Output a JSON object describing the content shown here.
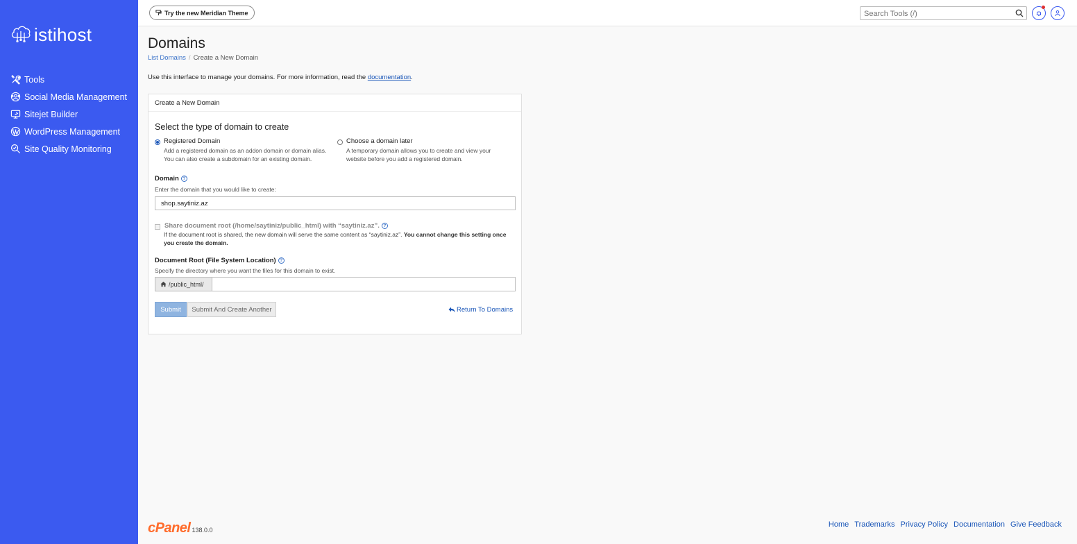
{
  "brand": {
    "name": "istihost",
    "sidebar_color": "#3b5af0"
  },
  "sidebar": {
    "items": [
      {
        "label": "Tools",
        "icon": "tools-icon"
      },
      {
        "label": "Social Media Management",
        "icon": "social-icon"
      },
      {
        "label": "Sitejet Builder",
        "icon": "monitor-icon"
      },
      {
        "label": "WordPress Management",
        "icon": "wordpress-icon"
      },
      {
        "label": "Site Quality Monitoring",
        "icon": "search-magnify-icon"
      }
    ]
  },
  "topbar": {
    "theme_button": "Try the new Meridian Theme",
    "search_placeholder": "Search Tools (/)"
  },
  "page": {
    "title": "Domains",
    "breadcrumb": {
      "parent": "List Domains",
      "current": "Create a New Domain"
    },
    "intro_text": "Use this interface to manage your domains. For more information, read the ",
    "intro_link": "documentation",
    "intro_end": "."
  },
  "panel": {
    "heading": "Create a New Domain",
    "section_title": "Select the type of domain to create",
    "options": [
      {
        "label": "Registered Domain",
        "desc1": "Add a registered domain as an addon domain or domain alias.",
        "desc2": "You can also create a subdomain for an existing domain.",
        "selected": true
      },
      {
        "label": "Choose a domain later",
        "desc1": "A temporary domain allows you to create and view your",
        "desc2": "website before you add a registered domain.",
        "selected": false
      }
    ],
    "domain_label": "Domain",
    "domain_hint": "Enter the domain that you would like to create:",
    "domain_value": "shop.saytiniz.az",
    "share_label": "Share document root (/home/saytiniz/public_html) with “saytiniz.az”.",
    "share_desc": "If the document root is shared, the new domain will serve the same content as “saytiniz.az”. ",
    "share_desc_bold": "You cannot change this setting once you create the domain.",
    "docroot_label": "Document Root (File System Location)",
    "docroot_hint": "Specify the directory where you want the files for this domain to exist.",
    "docroot_prefix": "/public_html/",
    "docroot_value": "",
    "submit_label": "Submit",
    "submit_another_label": "Submit And Create Another",
    "return_label": "Return To Domains"
  },
  "footer": {
    "logo": "cPanel",
    "version": "138.0.0",
    "links": [
      "Home",
      "Trademarks",
      "Privacy Policy",
      "Documentation",
      "Give Feedback"
    ]
  }
}
